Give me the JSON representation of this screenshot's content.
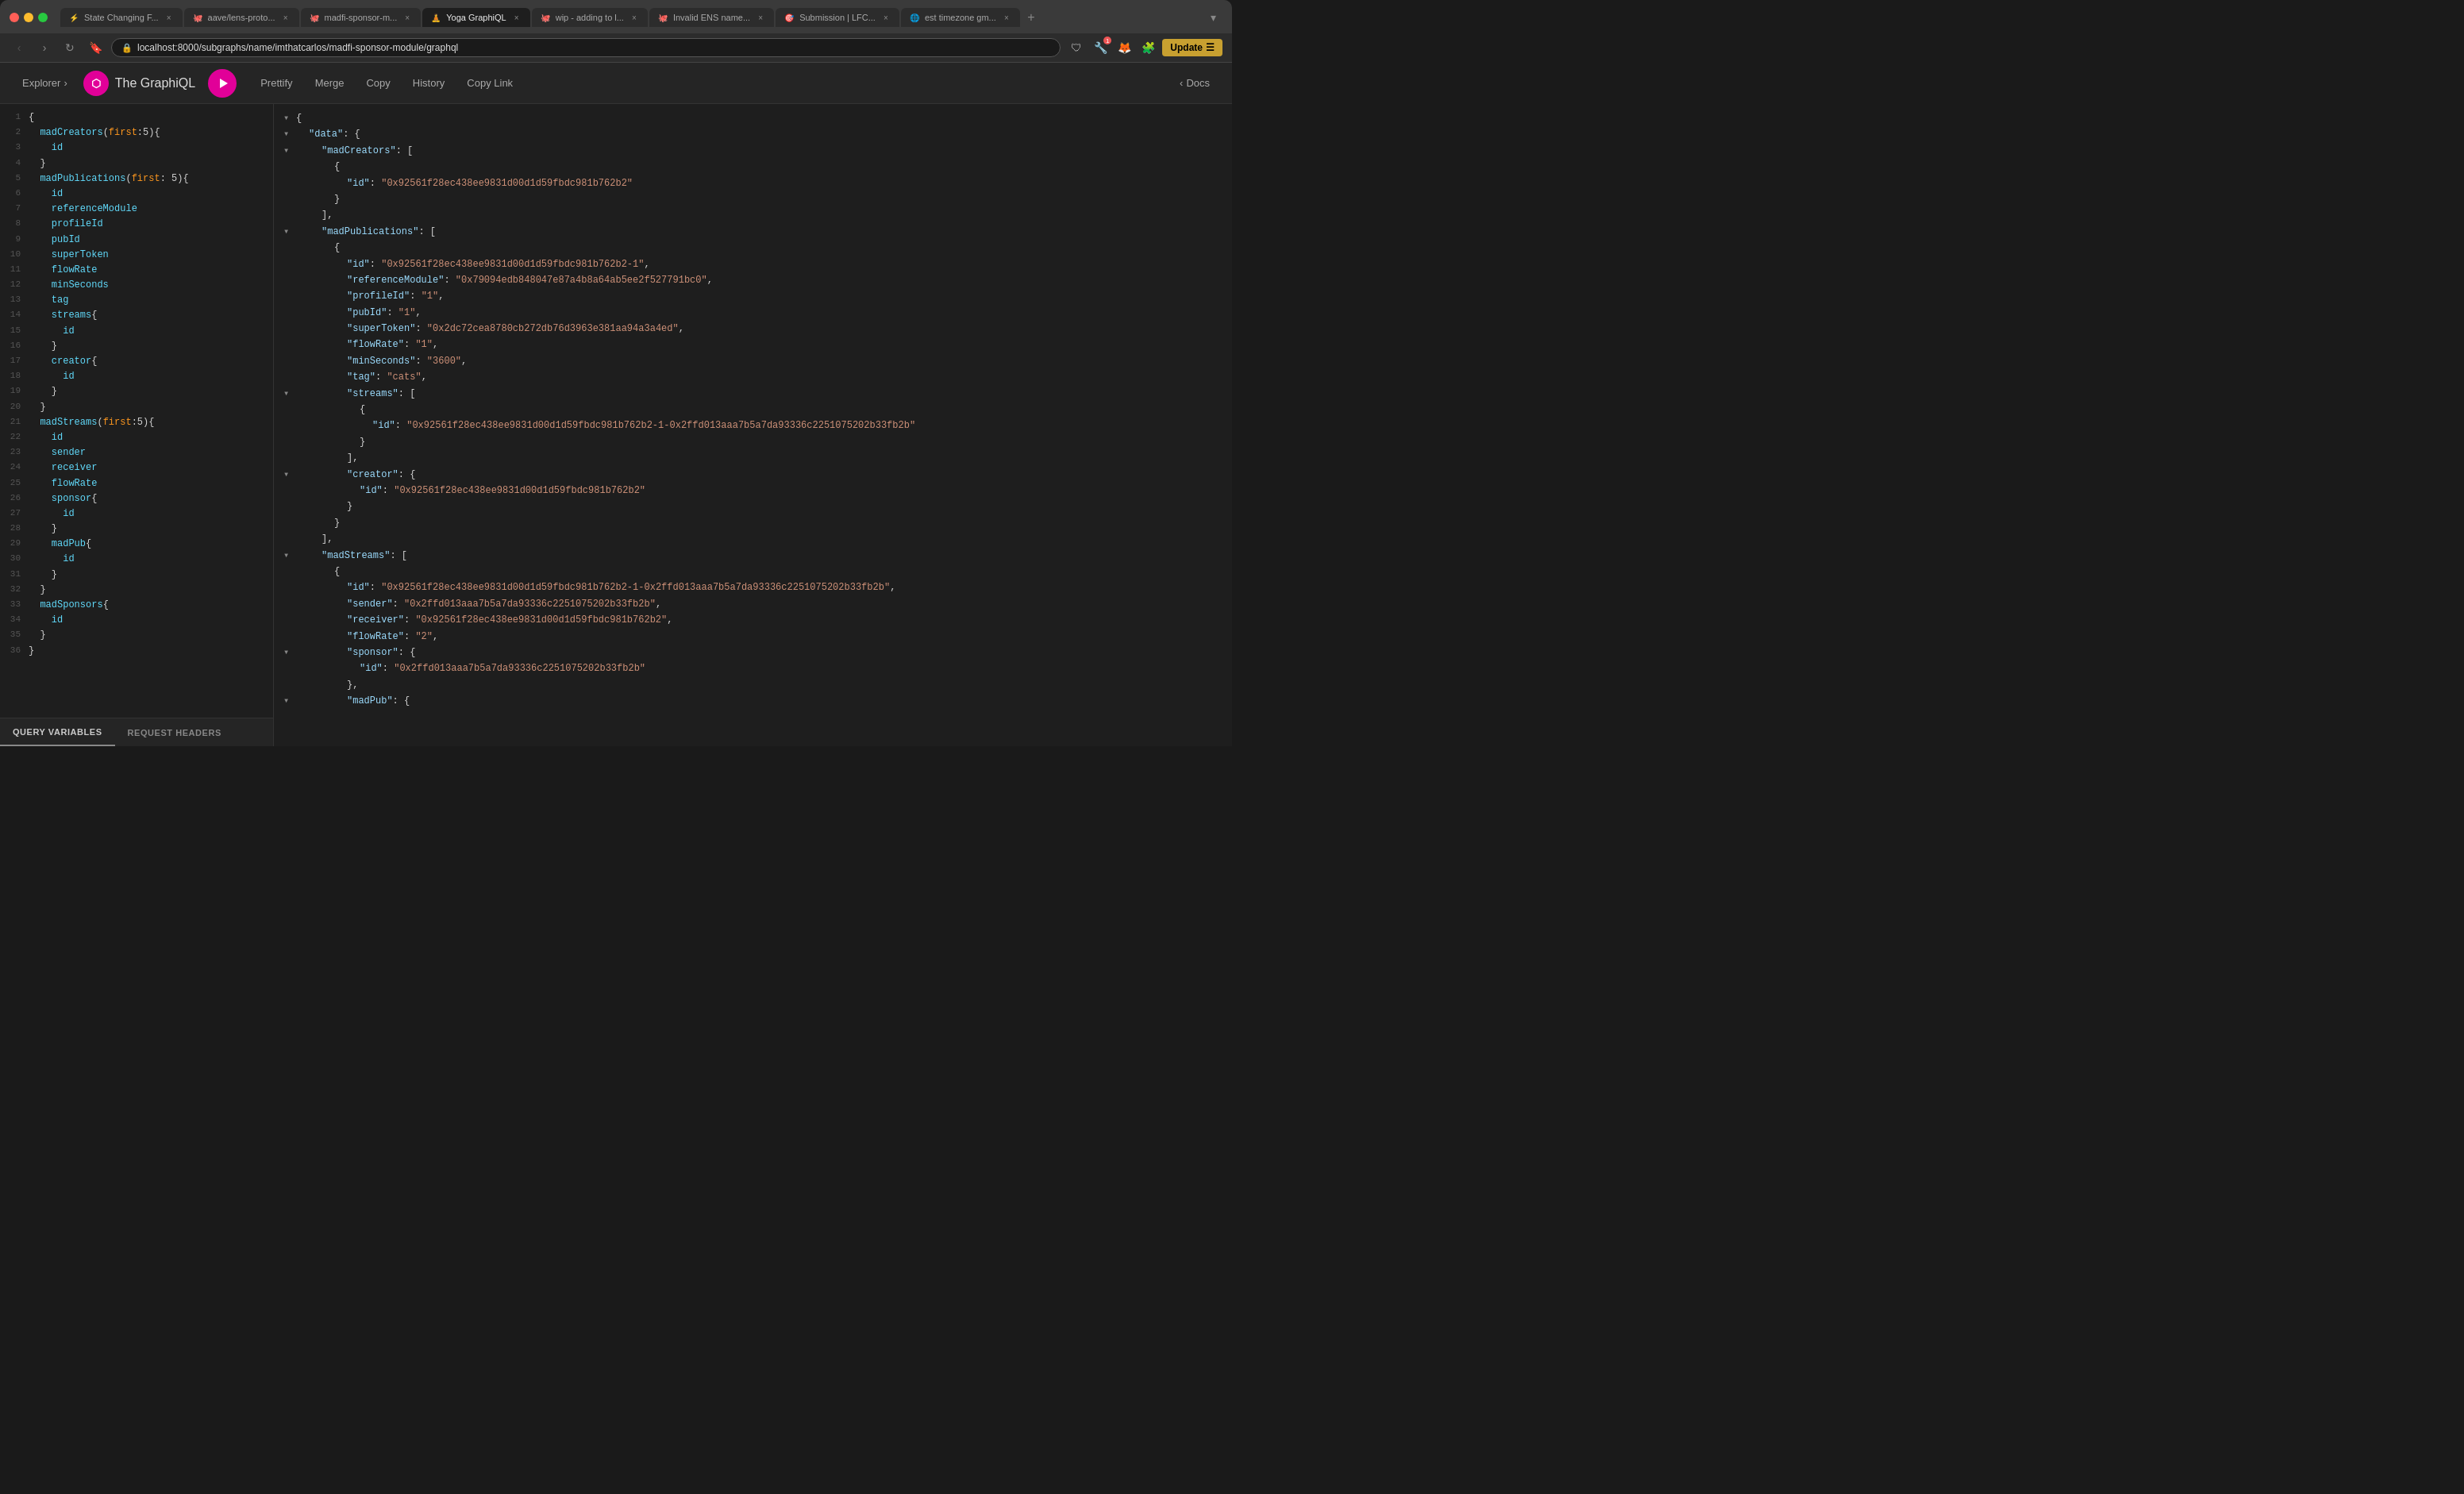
{
  "browser": {
    "traffic_lights": [
      "red",
      "yellow",
      "green"
    ],
    "tabs": [
      {
        "id": "t1",
        "label": "State Changing F...",
        "icon": "⚡",
        "active": false
      },
      {
        "id": "t2",
        "label": "aave/lens-proto...",
        "icon": "🐙",
        "active": false
      },
      {
        "id": "t3",
        "label": "madfi-sponsor-m...",
        "icon": "🐙",
        "active": false
      },
      {
        "id": "t4",
        "label": "Yoga GraphiQL",
        "icon": "🧘",
        "active": true
      },
      {
        "id": "t5",
        "label": "wip - adding to l...",
        "icon": "🐙",
        "active": false
      },
      {
        "id": "t6",
        "label": "Invalid ENS name...",
        "icon": "🐙",
        "active": false
      },
      {
        "id": "t7",
        "label": "Submission | LFC...",
        "icon": "🎯",
        "active": false
      },
      {
        "id": "t8",
        "label": "est timezone gm...",
        "icon": "🌐",
        "active": false
      }
    ],
    "url": "localhost:8000/subgraphs/name/imthatcarlos/madfi-sponsor-module/graphql",
    "update_btn": "Update"
  },
  "graphiql": {
    "title": "The GraphiQL",
    "nav": {
      "explorer": "Explorer",
      "prettify": "Prettify",
      "merge": "Merge",
      "copy": "Copy",
      "history": "History",
      "copy_link": "Copy Link",
      "docs": "Docs"
    },
    "query": [
      {
        "line": 1,
        "content": "{"
      },
      {
        "line": 2,
        "content": "  madCreators(first:5){"
      },
      {
        "line": 3,
        "content": "    id"
      },
      {
        "line": 4,
        "content": "  }"
      },
      {
        "line": 5,
        "content": "  madPublications(first: 5){"
      },
      {
        "line": 6,
        "content": "    id"
      },
      {
        "line": 7,
        "content": "    referenceModule"
      },
      {
        "line": 8,
        "content": "    profileId"
      },
      {
        "line": 9,
        "content": "    pubId"
      },
      {
        "line": 10,
        "content": "    superToken"
      },
      {
        "line": 11,
        "content": "    flowRate"
      },
      {
        "line": 12,
        "content": "    minSeconds"
      },
      {
        "line": 13,
        "content": "    tag"
      },
      {
        "line": 14,
        "content": "    streams{"
      },
      {
        "line": 15,
        "content": "      id"
      },
      {
        "line": 16,
        "content": "    }"
      },
      {
        "line": 17,
        "content": "    creator{"
      },
      {
        "line": 18,
        "content": "      id"
      },
      {
        "line": 19,
        "content": "    }"
      },
      {
        "line": 20,
        "content": "  }"
      },
      {
        "line": 21,
        "content": "  madStreams(first:5){"
      },
      {
        "line": 22,
        "content": "    id"
      },
      {
        "line": 23,
        "content": "    sender"
      },
      {
        "line": 24,
        "content": "    receiver"
      },
      {
        "line": 25,
        "content": "    flowRate"
      },
      {
        "line": 26,
        "content": "    sponsor{"
      },
      {
        "line": 27,
        "content": "      id"
      },
      {
        "line": 28,
        "content": "    }"
      },
      {
        "line": 29,
        "content": "    madPub{"
      },
      {
        "line": 30,
        "content": "      id"
      },
      {
        "line": 31,
        "content": "    }"
      },
      {
        "line": 32,
        "content": "  }"
      },
      {
        "line": 33,
        "content": "  madSponsors{"
      },
      {
        "line": 34,
        "content": "    id"
      },
      {
        "line": 35,
        "content": "  }"
      },
      {
        "line": 36,
        "content": "}"
      }
    ],
    "result": {
      "data": {
        "madCreators": [
          {
            "id": "0x92561f28ec438ee9831d00d1d59fbdc981b762b2"
          }
        ],
        "madPublications": [
          {
            "id": "0x92561f28ec438ee9831d00d1d59fbdc981b762b2-1",
            "referenceModule": "0x79094edb848047e87a4b8a64ab5ee2f527791bc0",
            "profileId": "1",
            "pubId": "1",
            "superToken": "0x2dc72cea8780cb272db76d3963e381aa94a3a4ed",
            "flowRate": "1",
            "minSeconds": "3600",
            "tag": "cats",
            "streams": [
              {
                "id": "0x92561f28ec438ee9831d00d1d59fbdc981b762b2-1-0x2ffd013aaa7b5a7da93336c2251075202b33fb2b"
              }
            ],
            "creator": {
              "id": "0x92561f28ec438ee9831d00d1d59fbdc981b762b2"
            }
          }
        ],
        "madStreams": [
          {
            "id": "0x92561f28ec438ee9831d00d1d59fbdc981b762b2-1-0x2ffd013aaa7b5a7da93336c2251075202b33fb2b",
            "sender": "0x2ffd013aaa7b5a7da93336c2251075202b33fb2b",
            "receiver": "0x92561f28ec438ee9831d00d1d59fbdc981b762b2",
            "flowRate": "2",
            "sponsor": {
              "id": "0x2ffd013aaa7b5a7da93336c2251075202b33fb2b"
            },
            "madPub": {}
          }
        ]
      }
    }
  },
  "bottom_tabs": {
    "query_variables": "QUERY VARIABLES",
    "request_headers": "REQUEST HEADERS"
  }
}
